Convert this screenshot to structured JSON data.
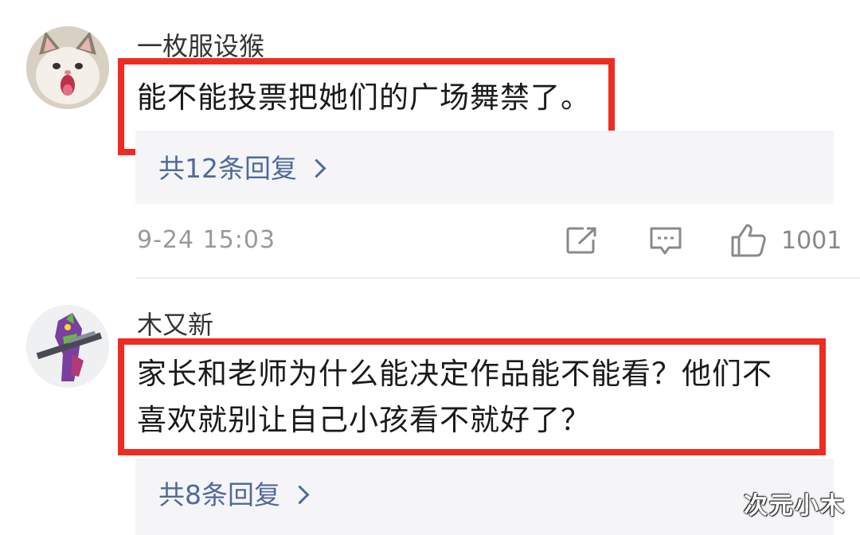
{
  "comments": [
    {
      "username": "一枚服设猴",
      "avatar_icon": "cat-avatar-icon",
      "content": "能不能投票把她们的广场舞禁了。",
      "reply_link": "共12条回复",
      "timestamp": "9-24 15:03",
      "share_icon": "share-icon",
      "comment_icon": "comment-icon",
      "like_icon": "thumbs-up-icon",
      "like_count": "1001"
    },
    {
      "username": "木又新",
      "avatar_icon": "mecha-avatar-icon",
      "content_line1": "家长和老师为什么能决定作品能不能看？他们不",
      "content_line2": "喜欢就别让自己小孩看不就好了？",
      "reply_link": "共8条回复"
    }
  ],
  "watermark": "次元小木",
  "colors": {
    "highlight": "#ee2c21",
    "reply_link": "#506a99",
    "reply_panel": "#f5f5f7",
    "meta_text": "#999999"
  }
}
